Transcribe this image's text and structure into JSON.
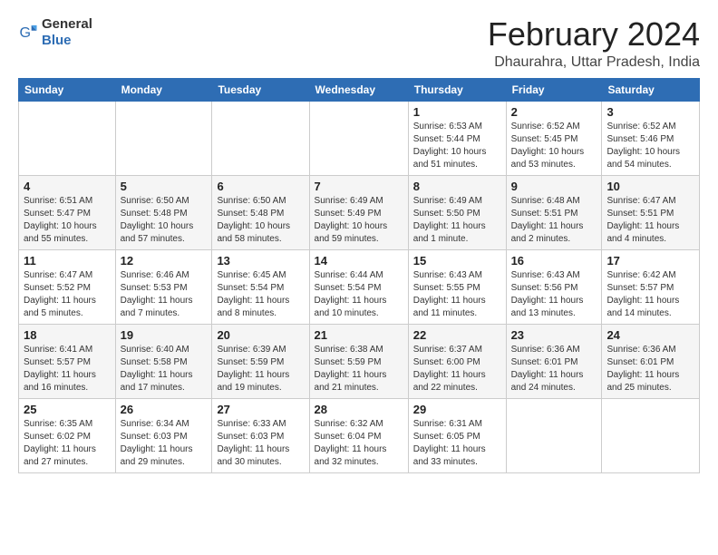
{
  "header": {
    "logo_general": "General",
    "logo_blue": "Blue",
    "month_title": "February 2024",
    "location": "Dhaurahra, Uttar Pradesh, India"
  },
  "weekdays": [
    "Sunday",
    "Monday",
    "Tuesday",
    "Wednesday",
    "Thursday",
    "Friday",
    "Saturday"
  ],
  "weeks": [
    [
      {
        "day": "",
        "detail": ""
      },
      {
        "day": "",
        "detail": ""
      },
      {
        "day": "",
        "detail": ""
      },
      {
        "day": "",
        "detail": ""
      },
      {
        "day": "1",
        "detail": "Sunrise: 6:53 AM\nSunset: 5:44 PM\nDaylight: 10 hours\nand 51 minutes."
      },
      {
        "day": "2",
        "detail": "Sunrise: 6:52 AM\nSunset: 5:45 PM\nDaylight: 10 hours\nand 53 minutes."
      },
      {
        "day": "3",
        "detail": "Sunrise: 6:52 AM\nSunset: 5:46 PM\nDaylight: 10 hours\nand 54 minutes."
      }
    ],
    [
      {
        "day": "4",
        "detail": "Sunrise: 6:51 AM\nSunset: 5:47 PM\nDaylight: 10 hours\nand 55 minutes."
      },
      {
        "day": "5",
        "detail": "Sunrise: 6:50 AM\nSunset: 5:48 PM\nDaylight: 10 hours\nand 57 minutes."
      },
      {
        "day": "6",
        "detail": "Sunrise: 6:50 AM\nSunset: 5:48 PM\nDaylight: 10 hours\nand 58 minutes."
      },
      {
        "day": "7",
        "detail": "Sunrise: 6:49 AM\nSunset: 5:49 PM\nDaylight: 10 hours\nand 59 minutes."
      },
      {
        "day": "8",
        "detail": "Sunrise: 6:49 AM\nSunset: 5:50 PM\nDaylight: 11 hours\nand 1 minute."
      },
      {
        "day": "9",
        "detail": "Sunrise: 6:48 AM\nSunset: 5:51 PM\nDaylight: 11 hours\nand 2 minutes."
      },
      {
        "day": "10",
        "detail": "Sunrise: 6:47 AM\nSunset: 5:51 PM\nDaylight: 11 hours\nand 4 minutes."
      }
    ],
    [
      {
        "day": "11",
        "detail": "Sunrise: 6:47 AM\nSunset: 5:52 PM\nDaylight: 11 hours\nand 5 minutes."
      },
      {
        "day": "12",
        "detail": "Sunrise: 6:46 AM\nSunset: 5:53 PM\nDaylight: 11 hours\nand 7 minutes."
      },
      {
        "day": "13",
        "detail": "Sunrise: 6:45 AM\nSunset: 5:54 PM\nDaylight: 11 hours\nand 8 minutes."
      },
      {
        "day": "14",
        "detail": "Sunrise: 6:44 AM\nSunset: 5:54 PM\nDaylight: 11 hours\nand 10 minutes."
      },
      {
        "day": "15",
        "detail": "Sunrise: 6:43 AM\nSunset: 5:55 PM\nDaylight: 11 hours\nand 11 minutes."
      },
      {
        "day": "16",
        "detail": "Sunrise: 6:43 AM\nSunset: 5:56 PM\nDaylight: 11 hours\nand 13 minutes."
      },
      {
        "day": "17",
        "detail": "Sunrise: 6:42 AM\nSunset: 5:57 PM\nDaylight: 11 hours\nand 14 minutes."
      }
    ],
    [
      {
        "day": "18",
        "detail": "Sunrise: 6:41 AM\nSunset: 5:57 PM\nDaylight: 11 hours\nand 16 minutes."
      },
      {
        "day": "19",
        "detail": "Sunrise: 6:40 AM\nSunset: 5:58 PM\nDaylight: 11 hours\nand 17 minutes."
      },
      {
        "day": "20",
        "detail": "Sunrise: 6:39 AM\nSunset: 5:59 PM\nDaylight: 11 hours\nand 19 minutes."
      },
      {
        "day": "21",
        "detail": "Sunrise: 6:38 AM\nSunset: 5:59 PM\nDaylight: 11 hours\nand 21 minutes."
      },
      {
        "day": "22",
        "detail": "Sunrise: 6:37 AM\nSunset: 6:00 PM\nDaylight: 11 hours\nand 22 minutes."
      },
      {
        "day": "23",
        "detail": "Sunrise: 6:36 AM\nSunset: 6:01 PM\nDaylight: 11 hours\nand 24 minutes."
      },
      {
        "day": "24",
        "detail": "Sunrise: 6:36 AM\nSunset: 6:01 PM\nDaylight: 11 hours\nand 25 minutes."
      }
    ],
    [
      {
        "day": "25",
        "detail": "Sunrise: 6:35 AM\nSunset: 6:02 PM\nDaylight: 11 hours\nand 27 minutes."
      },
      {
        "day": "26",
        "detail": "Sunrise: 6:34 AM\nSunset: 6:03 PM\nDaylight: 11 hours\nand 29 minutes."
      },
      {
        "day": "27",
        "detail": "Sunrise: 6:33 AM\nSunset: 6:03 PM\nDaylight: 11 hours\nand 30 minutes."
      },
      {
        "day": "28",
        "detail": "Sunrise: 6:32 AM\nSunset: 6:04 PM\nDaylight: 11 hours\nand 32 minutes."
      },
      {
        "day": "29",
        "detail": "Sunrise: 6:31 AM\nSunset: 6:05 PM\nDaylight: 11 hours\nand 33 minutes."
      },
      {
        "day": "",
        "detail": ""
      },
      {
        "day": "",
        "detail": ""
      }
    ]
  ]
}
